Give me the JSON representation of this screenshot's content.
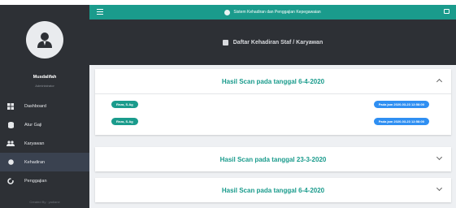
{
  "app": {
    "title": "Sistem Kehadiran dan Penggajian Kepegawaian"
  },
  "sidebar": {
    "user_name": "Musdalifah",
    "user_role": "Administrator",
    "items": [
      {
        "label": "Dashboard",
        "icon": "dashboard-icon",
        "active": false
      },
      {
        "label": "Atur Gaji",
        "icon": "database-icon",
        "active": false
      },
      {
        "label": "Karyawan",
        "icon": "users-icon",
        "active": false
      },
      {
        "label": "Kehadiran",
        "icon": "circle-icon",
        "active": true
      },
      {
        "label": "Penggajian",
        "icon": "refresh-icon",
        "active": false
      }
    ],
    "credit": "Created By : yadiane"
  },
  "page": {
    "heading": "Daftar Kehadiran Staf / Karyawan"
  },
  "cards": [
    {
      "title": "Hasil Scan pada tanggal 6-4-2020",
      "expanded": true,
      "entries": [
        {
          "name": "Reza, S.Ag",
          "time": "Pada jam 2020-03-23 12:58:00"
        },
        {
          "name": "Reza, S.Ag",
          "time": "Pada jam 2020-03-23 12:58:00"
        }
      ]
    },
    {
      "title": "Hasil Scan pada tanggal 23-3-2020",
      "expanded": false
    },
    {
      "title": "Hasil Scan pada tanggal 6-4-2020",
      "expanded": false
    }
  ],
  "colors": {
    "accent": "#1a9b8c",
    "sidebar": "#2d3035",
    "time_badge": "#2f8ff2"
  }
}
